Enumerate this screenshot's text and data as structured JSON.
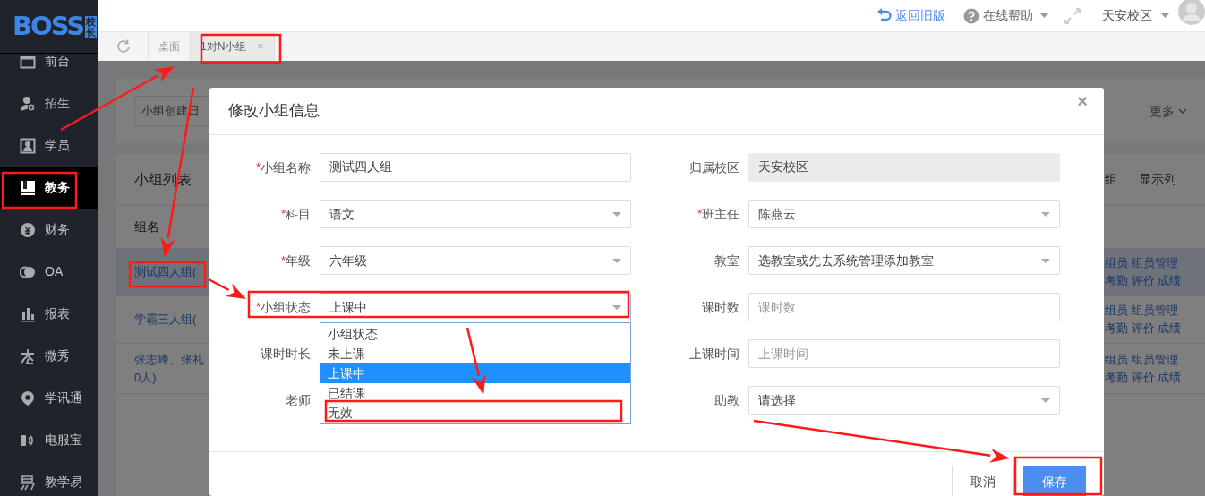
{
  "logo": {
    "text": "BOSS",
    "badge": "校长"
  },
  "sidebar": {
    "items": [
      {
        "label": "前台",
        "selected": false
      },
      {
        "label": "招生",
        "selected": false
      },
      {
        "label": "学员",
        "selected": false
      },
      {
        "label": "教务",
        "selected": true
      },
      {
        "label": "财务",
        "selected": false
      },
      {
        "label": "OA",
        "selected": false
      },
      {
        "label": "报表",
        "selected": false
      },
      {
        "label": "微秀",
        "selected": false
      },
      {
        "label": "学讯通",
        "selected": false
      },
      {
        "label": "电服宝",
        "selected": false
      },
      {
        "label": "教学易",
        "selected": false
      }
    ]
  },
  "topbar": {
    "back_link": "返回旧版",
    "help": "在线帮助",
    "campus": "天安校区"
  },
  "tabs": [
    {
      "label": "桌面",
      "selected": false,
      "closable": false
    },
    {
      "label": "1对N小组",
      "selected": true,
      "closable": true
    }
  ],
  "tab_close": "×",
  "background": {
    "filter_field": "小组创建日",
    "more": "更多",
    "list_title": "小组列表",
    "header_actions": [
      "组",
      "显示列"
    ],
    "column_header": "组名",
    "rows": [
      {
        "name_lines": [
          "测试四人组("
        ],
        "action_lines": [
          "组员 组员管理",
          "考勤 评价 成绩"
        ],
        "selected": true
      },
      {
        "name_lines": [
          "学霸三人组("
        ],
        "action_lines": [
          "组员 组员管理",
          "考勤 评价 成绩"
        ],
        "selected": false
      },
      {
        "name_lines": [
          "张志峰、张礼",
          "0人)"
        ],
        "action_lines": [
          "组员 组员管理",
          "考勤 评价 成绩"
        ],
        "selected": false
      }
    ]
  },
  "modal": {
    "title": "修改小组信息",
    "close": "×",
    "required_mark": "*",
    "rows": [
      {
        "left": {
          "label": "小组名称",
          "required": true,
          "kind": "text",
          "value": "测试四人组"
        },
        "right": {
          "label": "归属校区",
          "required": false,
          "kind": "text",
          "value": "天安校区",
          "disabled": true
        }
      },
      {
        "left": {
          "label": "科目",
          "required": true,
          "kind": "select",
          "value": "语文"
        },
        "right": {
          "label": "班主任",
          "required": true,
          "kind": "select",
          "value": "陈燕云"
        }
      },
      {
        "left": {
          "label": "年级",
          "required": true,
          "kind": "select",
          "value": "六年级"
        },
        "right": {
          "label": "教室",
          "required": false,
          "kind": "select",
          "value": "选教室或先去系统管理添加教室"
        }
      },
      {
        "left": {
          "label": "小组状态",
          "required": true,
          "kind": "select",
          "value": "上课中",
          "expanded": true
        },
        "right": {
          "label": "课时数",
          "required": false,
          "kind": "text",
          "placeholder": "课时数"
        }
      },
      {
        "left": {
          "label": "课时时长",
          "required": false,
          "kind": "hidden"
        },
        "right": {
          "label": "上课时间",
          "required": false,
          "kind": "text",
          "placeholder": "上课时间"
        }
      },
      {
        "left": {
          "label": "老师",
          "required": false,
          "kind": "hidden"
        },
        "right": {
          "label": "助教",
          "required": false,
          "kind": "select",
          "value": "请选择"
        }
      }
    ],
    "status_options": [
      {
        "label": "小组状态",
        "selected": false
      },
      {
        "label": "未上课",
        "selected": false
      },
      {
        "label": "上课中",
        "selected": true
      },
      {
        "label": "已结课",
        "selected": false
      },
      {
        "label": "无效",
        "selected": false
      }
    ],
    "buttons": [
      {
        "label": "取消",
        "kind": "secondary"
      },
      {
        "label": "保存",
        "kind": "primary"
      }
    ]
  }
}
